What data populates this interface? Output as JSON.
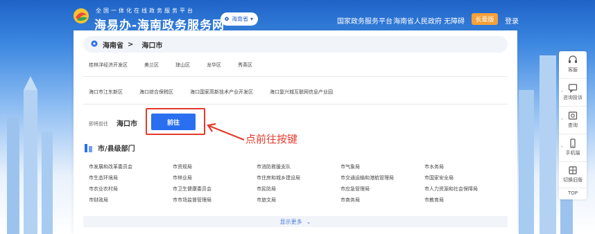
{
  "colors": {
    "accent": "#2a6ff0",
    "annotation": "#e53a2c",
    "elder": "#f6a03a"
  },
  "header": {
    "subtitle": "全国一体化在线政务服务平台",
    "title": "海易办-海南政务服务网",
    "region_selector": "海南省",
    "links": [
      "国家政务服务平台",
      "海南省人民政府",
      "无障碍"
    ],
    "elder_mode": "长辈版",
    "login": "登录"
  },
  "breadcrumb": {
    "province": "海南省",
    "separator": ">",
    "city": "海口市"
  },
  "districts_row1": [
    "桂林洋经济开发区",
    "美兰区",
    "琼山区",
    "龙华区",
    "秀英区"
  ],
  "districts_row2": [
    "海口市江东新区",
    "海口综合保税区",
    "海口国家高新技术产业开发区",
    "海口复兴城互联网信息产业园"
  ],
  "goto": {
    "label": "即将前往",
    "city": "海口市",
    "button": "前往"
  },
  "annotation": {
    "text": "点前往按键"
  },
  "departments": {
    "title": "市/县级部门",
    "items": [
      "市发展和改革委员会",
      "市资规局",
      "市消防救援支队",
      "市气象局",
      "市水务局",
      "市生态环境局",
      "市林业局",
      "市住房和城乡建设局",
      "市交通运输和港航管理局",
      "市国家安全局",
      "市农业农村局",
      "市卫生健康委员会",
      "市民防局",
      "市应急管理局",
      "市人力资源和社会保障局",
      "市财政局",
      "市市场监督管理局",
      "市旅文局",
      "市商务局",
      "市教育局"
    ],
    "more": "显示更多"
  },
  "toolbar": {
    "items": [
      {
        "label": "客服",
        "icon": "headset-icon"
      },
      {
        "label": "咨询投诉",
        "icon": "chat-icon"
      },
      {
        "label": "查询",
        "icon": "search-icon"
      },
      {
        "label": "手机端",
        "icon": "phone-icon"
      },
      {
        "label": "切换旧版",
        "icon": "switch-icon"
      }
    ],
    "top": "TOP"
  }
}
